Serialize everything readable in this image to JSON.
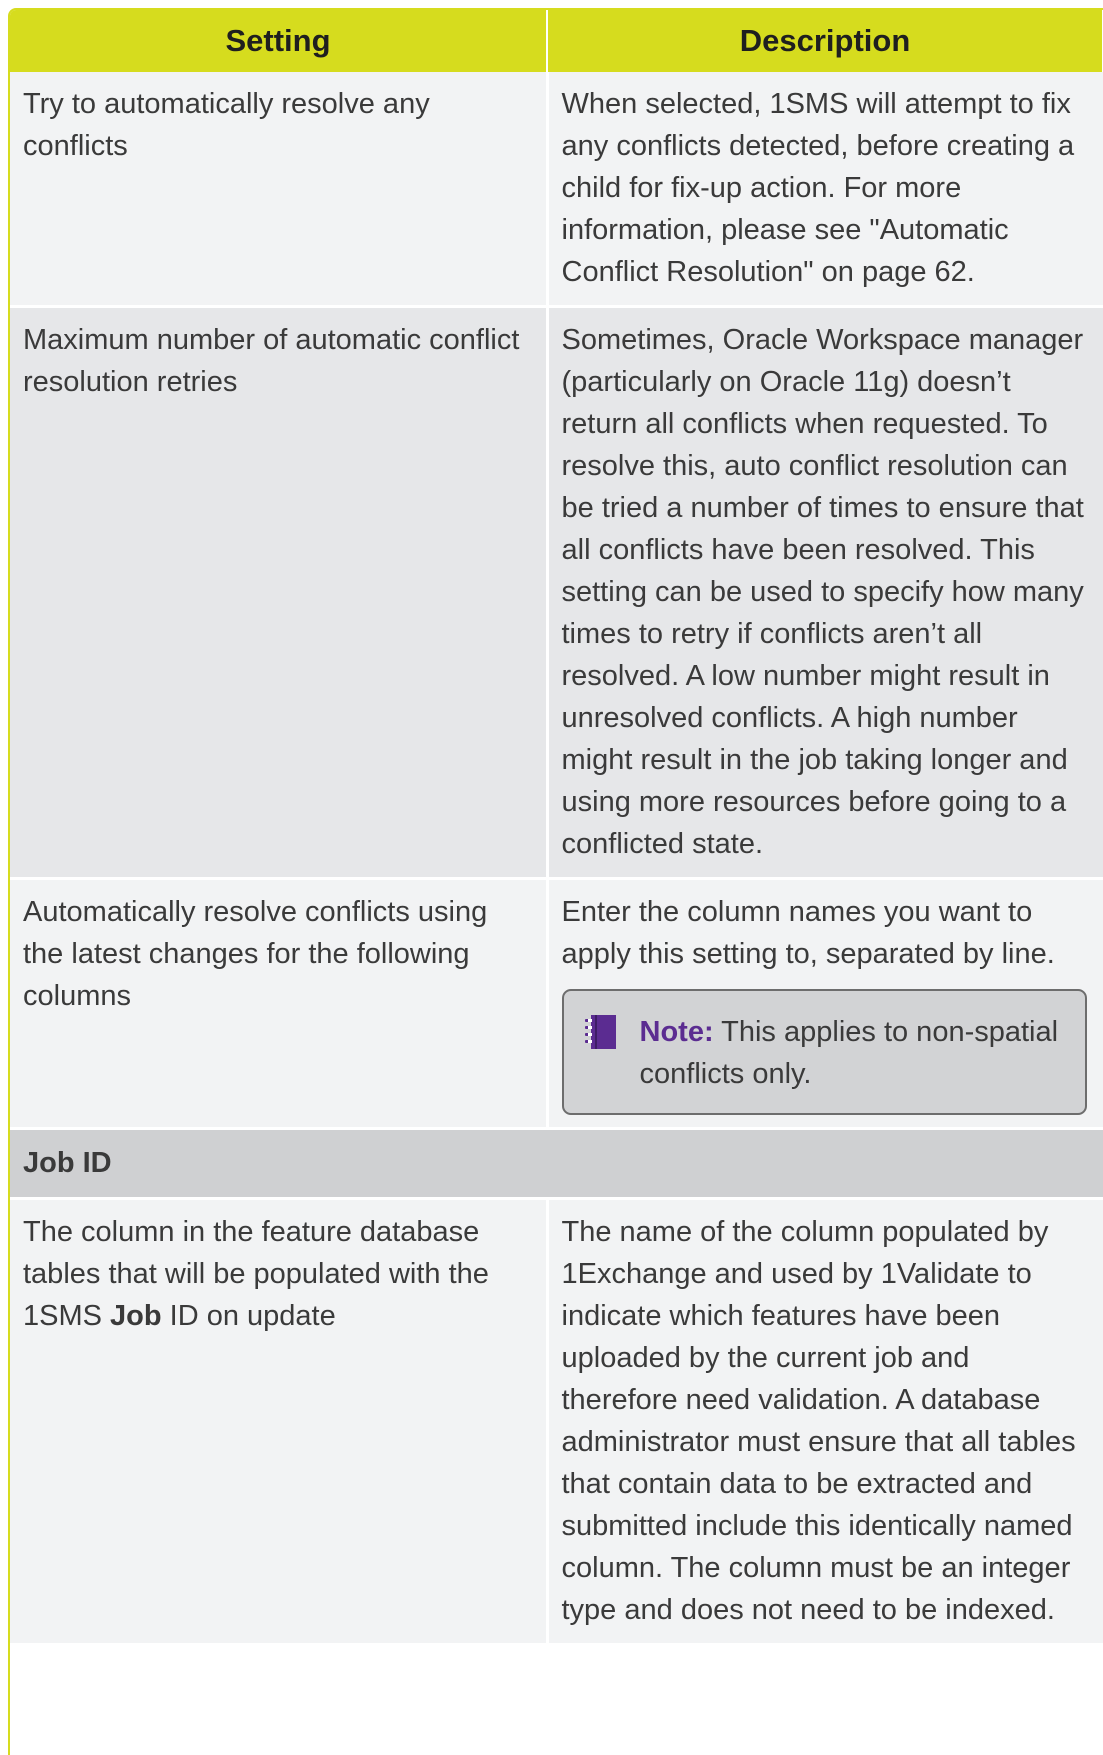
{
  "table": {
    "header": {
      "setting": "Setting",
      "description": "Description"
    },
    "rows": [
      {
        "setting": "Try to automatically resolve any conflicts",
        "description": "When selected, 1SMS will attempt to fix any conflicts detected, before creating a child for fix-up action. For more information, please see \"Automatic Conflict Resolution\" on page 62."
      },
      {
        "setting": "Maximum number of automatic conflict resolution retries",
        "description": "Sometimes, Oracle Workspace manager (particularly on Oracle 11g) doesn’t return all conflicts when requested. To resolve this, auto conflict resolution can be tried a number of times to ensure that all conflicts have been resolved. This setting can be used to specify how many times to retry if conflicts aren’t all resolved. A low number might result in unresolved conflicts. A high number might result in the job taking longer and using more resources before going to a conflicted state."
      },
      {
        "setting": "Automatically resolve conflicts using the latest changes for the following columns",
        "description": "Enter the column names you want to apply this setting to, separated by line.",
        "note": {
          "label": "Note:",
          "text": " This applies to non-spatial conflicts only.",
          "icon": "notebook-icon"
        }
      }
    ],
    "section": {
      "title": "Job ID"
    },
    "job_id_row": {
      "setting_before": "The column in the feature database tables that will be populated with the 1SMS ",
      "setting_bold": "Job",
      "setting_after": " ID on update",
      "description": "The name of the column populated by 1Exchange and used by 1Validate to indicate which features have been uploaded by the current job and therefore need validation. A database administrator must ensure that all tables that contain data to be extracted and submitted include this identically named column. The column must be an integer type and does not need to be indexed."
    }
  },
  "colors": {
    "header_bg": "#d6dc1e",
    "note_label": "#5b2c91",
    "section_bg": "#cfd0d2"
  }
}
